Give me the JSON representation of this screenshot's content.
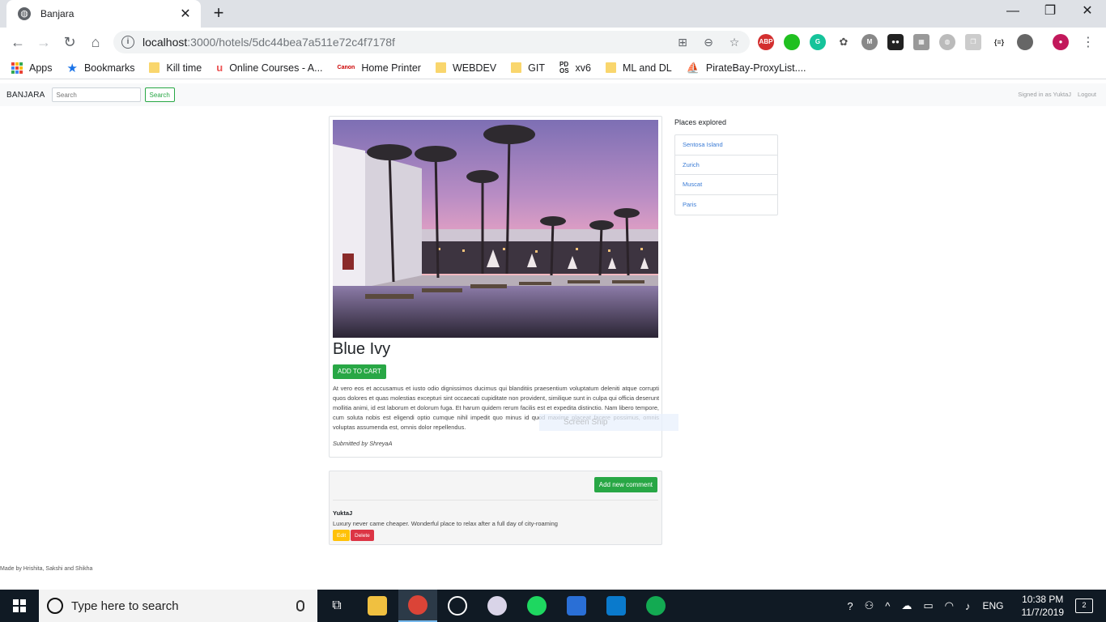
{
  "browser": {
    "tab_title": "Banjara",
    "url_host": "localhost",
    "url_path": ":3000/hotels/5dc44bea7a511e72c4f7178f",
    "bookmarks": [
      {
        "label": "Apps",
        "icon": "apps-grid-icon"
      },
      {
        "label": "Bookmarks",
        "icon": "star-icon"
      },
      {
        "label": "Kill time",
        "icon": "folder-icon"
      },
      {
        "label": "Online Courses - A...",
        "icon": "udemy-icon"
      },
      {
        "label": "Home Printer",
        "icon": "canon-icon"
      },
      {
        "label": "WEBDEV",
        "icon": "folder-icon"
      },
      {
        "label": "GIT",
        "icon": "folder-icon"
      },
      {
        "label": "xv6",
        "icon": "pdos-icon"
      },
      {
        "label": "ML and DL",
        "icon": "folder-icon"
      },
      {
        "label": "PirateBay-ProxyList....",
        "icon": "pirate-ship-icon"
      }
    ]
  },
  "navbar": {
    "brand": "BANJARA",
    "search_placeholder": "Search",
    "search_button": "Search",
    "signed_in": "Signed in as YuktaJ",
    "logout": "Logout"
  },
  "hotel": {
    "name": "Blue Ivy",
    "add_to_cart": "ADD TO CART",
    "description": "At vero eos et accusamus et iusto odio dignissimos ducimus qui blanditiis praesentium voluptatum deleniti atque corrupti quos dolores et quas molestias excepturi sint occaecati cupiditate non provident, similique sunt in culpa qui officia deserunt mollitia animi, id est laborum et dolorum fuga. Et harum quidem rerum facilis est et expedita distinctio. Nam libero tempore, cum soluta nobis est eligendi optio cumque nihil impedit quo minus id quod maxime placeat facere possimus, omnis voluptas assumenda est, omnis dolor repellendus.",
    "submitted_by": "Submitted by ShreyaA"
  },
  "snip_overlay": "Screen Snip",
  "comments": {
    "add_button": "Add new comment",
    "items": [
      {
        "author": "YuktaJ",
        "text": "Luxury never came cheaper. Wonderful place to relax after a full day of city-roaming",
        "edit": "Edit",
        "delete": "Delete"
      }
    ]
  },
  "places": {
    "title": "Places explored",
    "items": [
      "Sentosa Island",
      "Zurich",
      "Muscat",
      "Paris"
    ]
  },
  "footer": "Made by Hrishita, Sakshi and Shikha",
  "taskbar": {
    "search_placeholder": "Type here to search",
    "language": "ENG",
    "time": "10:38 PM",
    "date": "11/7/2019",
    "notifications": "2"
  },
  "colors": {
    "success": "#28a745",
    "warning": "#ffc107",
    "danger": "#dc3545",
    "link": "#3a7bd5"
  }
}
